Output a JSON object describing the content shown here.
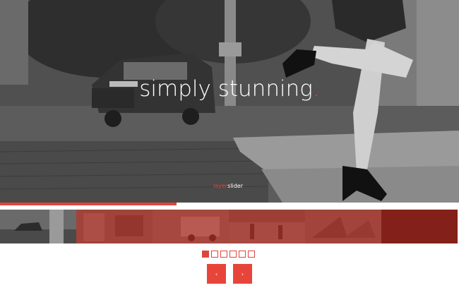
{
  "slide": {
    "headline": "simply stunning",
    "headline_dot": ".",
    "watermark_accent": "layer",
    "watermark_text": "slider"
  },
  "progress": {
    "fraction": 0.385,
    "color": "#e0453b"
  },
  "thumbnails": [
    {
      "scene": "street-car",
      "active": true
    },
    {
      "scene": "shop-interior",
      "active": false
    },
    {
      "scene": "van-street",
      "active": false
    },
    {
      "scene": "plaza-people",
      "active": false
    },
    {
      "scene": "boats-harbor",
      "active": false
    },
    {
      "scene": "dark",
      "active": false
    }
  ],
  "bullets": {
    "count": 6,
    "active_index": 0
  },
  "navigation": {
    "prev_label": "‹",
    "next_label": "›"
  },
  "colors": {
    "accent": "#e0453b",
    "tint": "#aa281c"
  }
}
